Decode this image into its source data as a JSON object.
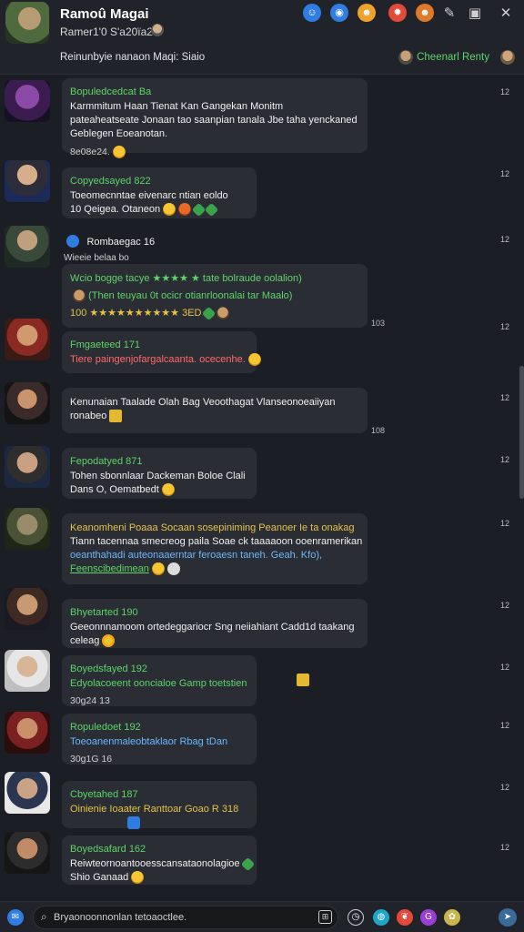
{
  "header": {
    "name": "Ramoû Magai",
    "subtitle": "Ramer1'0 S'a20ïa2",
    "topic": "Reinunbyie  nanaon Maqi: Siaio",
    "status": "Cheenarl Renty",
    "tools": [
      "person-icon",
      "reddit-icon",
      "emoji-icon",
      "fire-icon",
      "face-icon",
      "wrench-icon",
      "window-icon",
      "close-icon"
    ]
  },
  "messages": [
    {
      "sender": "Bopuledcedcat Ba",
      "text_lines": [
        "Karmmitum Haan Tienat Kan Gangekan Monitm",
        "pateaheatseate Jonaan tao saanpian tanala Jbe taha yenckaned",
        "Geblegen Eoeanotan."
      ],
      "meta": "8e08e24.",
      "time": "12"
    },
    {
      "sender": "Copyedsayed 822",
      "text_lines": [
        "Toeomecnntae eivenarc ntian eoldo",
        "10 Qeigea. Otaneon"
      ],
      "meta": "",
      "time": "12"
    },
    {
      "sender": "Rombaegac 16",
      "subline": "Wieeie belaa bo",
      "lines": [
        "Wcio bogge tacye ★★★★ ★ tate bolraude oolalion)",
        "(Then teuyau 0t ocicr otianrloonalai tar Maalo)",
        "100 ★★★★★★★★★★ 3ED"
      ],
      "time": "12",
      "bigtime": "103"
    },
    {
      "sender": "Fmgaeteed 171",
      "text_lines": [
        "Tiere paingenjofargalcaanta. ocecenhe."
      ],
      "hl": "ofargalcaanta. ocecenhe.",
      "time": "12"
    },
    {
      "sender": "Kenunaian",
      "text_lines": [
        "Kenunaian Taalade Olah Bag Veoothagat Vlanseonoeaiiyan",
        "ronabeo"
      ],
      "time": "12",
      "bigtime": "108"
    },
    {
      "sender": "Fepodatyed 871",
      "text_lines": [
        "Tohen sbonnlaar Dackeman Boloe Clali",
        "Dans O, Oematbedt"
      ],
      "time": "12"
    },
    {
      "sender": "Keanomheni",
      "text_lines": [
        "Keanomheni  Poaaa Socaan sosepiniming Peanoer Ie ta onakag",
        "Tiann tacennaa smecreog paila Soae ck taaaaoon ooenramerikan",
        "oeanthahadi auteonaaerntar feroaesn taneh. Geah. Kfo),",
        "Feenscibedimean"
      ],
      "time": "12"
    },
    {
      "sender": "Bhyetarted 190",
      "text_lines": [
        "Geeonnnamoom ortedeggariocr Sng neiiahiant Cadd1d taakang",
        "celeag"
      ],
      "time": "12"
    },
    {
      "sender": "Boyedsfayed 192",
      "text_lines": [
        "Edyolacoeent ooncialoe Gamp toetstien"
      ],
      "meta": "30g24 13",
      "time": "12"
    },
    {
      "sender": "Ropuledoet 192",
      "text_lines": [
        "Toeoanenmaleobtaklaor  Rbag tDan"
      ],
      "meta": "30g1G 16",
      "time": "12"
    },
    {
      "sender": "Cbyetahed 187",
      "text_lines": [
        "Oinienie Ioaater Ranttoar Goao R 318"
      ],
      "time": "12"
    },
    {
      "sender": "Boyedsafard 162",
      "text_lines": [
        "Reiwteornoantooesscansataonolagioe",
        "Shio Ganaad"
      ],
      "time": "12"
    }
  ],
  "inputbar": {
    "placeholder": "Bryaonoonnonlan tetoaoctlee.",
    "buttons": [
      "discord-icon",
      "clock-icon",
      "globe-icon",
      "cat-icon",
      "gif-icon",
      "send-icon"
    ]
  },
  "colors": {
    "background": "#1b1e24",
    "bubble": "#2a2d33",
    "accent_green": "#5fd46a"
  }
}
